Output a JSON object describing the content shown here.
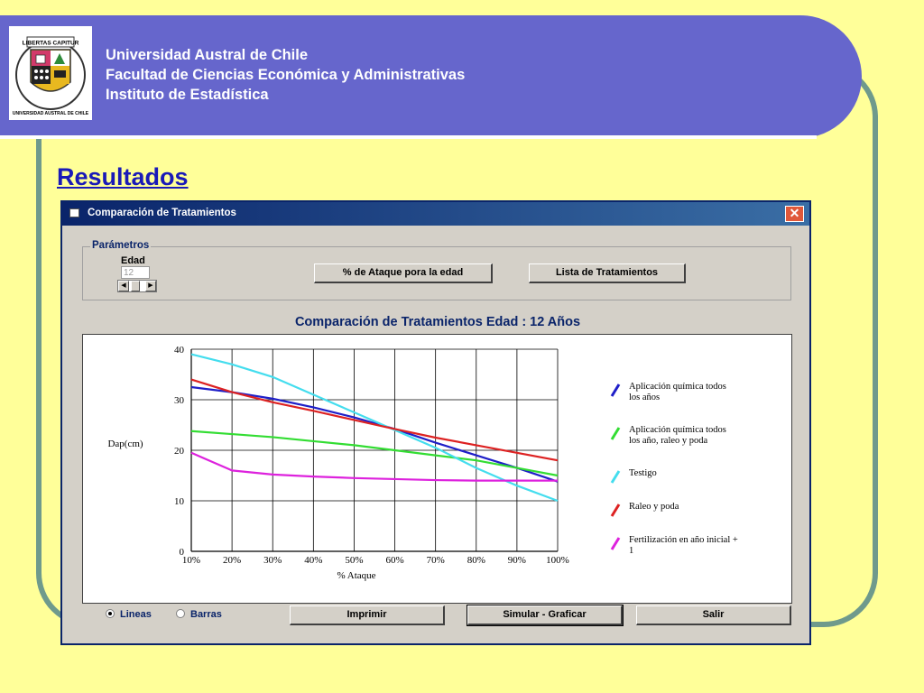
{
  "header": {
    "line1": "Universidad Austral de Chile",
    "line2": "Facultad de Ciencias Económica y Administrativas",
    "line3": "Instituto de Estadística",
    "logo_text_top": "LIBERTAS CAPITUR",
    "logo_text_ring": "UNIVERSIDAD AUSTRAL DE CHILE"
  },
  "slide_title": "Resultados",
  "window": {
    "title": "Comparación de Tratamientos",
    "params_legend": "Parámetros",
    "edad_label": "Edad",
    "edad_value": "12",
    "btn_ataque": "% de Ataque pora la edad",
    "btn_lista": "Lista de Tratamientos",
    "chart_heading": "Comparación de Tratamientos Edad : 12 Años",
    "radio_lineas": "Lineas",
    "radio_barras": "Barras",
    "btn_imprimir": "Imprimir",
    "btn_simular": "Simular - Graficar",
    "btn_salir": "Salir"
  },
  "chart_data": {
    "type": "line",
    "xlabel": "% Ataque",
    "ylabel": "Dap(cm)",
    "x_tick_labels": [
      "10%",
      "20%",
      "30%",
      "40%",
      "50%",
      "60%",
      "70%",
      "80%",
      "90%",
      "100%"
    ],
    "x": [
      10,
      20,
      30,
      40,
      50,
      60,
      70,
      80,
      90,
      100
    ],
    "ylim": [
      0,
      40
    ],
    "y_ticks": [
      "0",
      "10",
      "20",
      "30",
      "40"
    ],
    "grid": true,
    "legend_placement": "right",
    "series": [
      {
        "name_lines": [
          "Aplicación química todos",
          "los años"
        ],
        "color": "#1f1fc8",
        "values": [
          32.5,
          31.5,
          30.2,
          28.5,
          26.5,
          24.2,
          21.5,
          19,
          16.5,
          13.8
        ]
      },
      {
        "name_lines": [
          "Aplicación química todos",
          "los año, raleo y poda"
        ],
        "color": "#33dd33",
        "values": [
          23.8,
          23.2,
          22.6,
          21.8,
          21,
          20,
          19,
          18,
          16.5,
          15
        ]
      },
      {
        "name_lines": [
          "Testigo"
        ],
        "color": "#44ddee",
        "values": [
          39,
          37,
          34.5,
          31,
          27.5,
          24,
          20.5,
          16.5,
          13,
          10
        ]
      },
      {
        "name_lines": [
          "Raleo y poda"
        ],
        "color": "#dd2222",
        "values": [
          34,
          31.5,
          29.5,
          27.8,
          26,
          24.2,
          22.5,
          21,
          19.5,
          18
        ]
      },
      {
        "name_lines": [
          "Fertilización en año inicial +",
          "1"
        ],
        "color": "#dd22dd",
        "values": [
          19.5,
          16,
          15.2,
          14.8,
          14.5,
          14.3,
          14.1,
          14,
          14,
          14
        ]
      }
    ]
  }
}
